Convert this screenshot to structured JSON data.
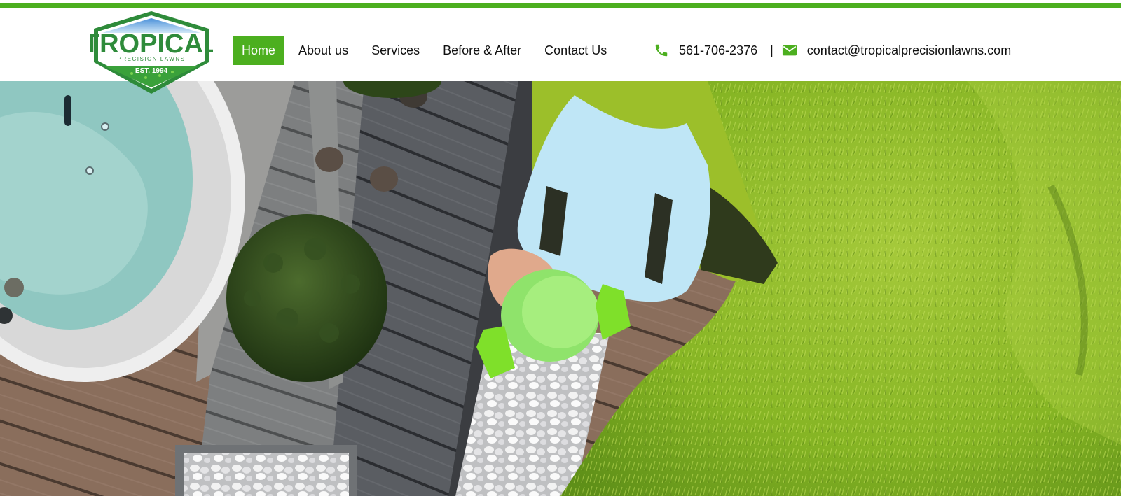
{
  "brand": {
    "logo_name": "TROPICAL",
    "logo_tagline": "PRECISION LAWNS",
    "logo_est": "EST. 1994",
    "accent_color": "#4caf1f",
    "logo_green": "#2e8b3a"
  },
  "nav": {
    "items": [
      {
        "label": "Home",
        "active": true
      },
      {
        "label": "About us",
        "active": false
      },
      {
        "label": "Services",
        "active": false
      },
      {
        "label": "Before & After",
        "active": false
      },
      {
        "label": "Contact Us",
        "active": false
      }
    ]
  },
  "contact": {
    "phone_icon": "phone-icon",
    "phone": "561-706-2376",
    "separator": "|",
    "email_icon": "envelope-icon",
    "email": "contact@tropicalprecisionlawns.com"
  },
  "hero": {
    "image_subject": "hero-photo"
  }
}
